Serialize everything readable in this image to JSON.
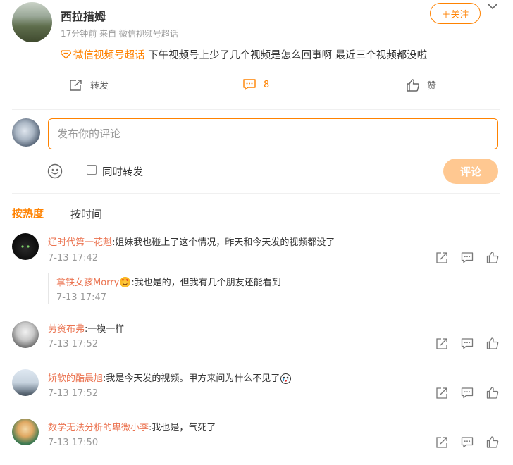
{
  "post": {
    "author": "西拉措姆",
    "meta": "17分钟前  来自 微信视频号超话",
    "follow_label": "＋关注",
    "topic": "微信视频号超话",
    "text": " 下午视频号上少了几个视频是怎么回事啊 最近三个视频都没啦",
    "actions": {
      "repost_label": "转发",
      "comment_count": "8",
      "like_label": "赞"
    }
  },
  "composer": {
    "placeholder": "发布你的评论",
    "repost_checkbox_label": "同时转发",
    "submit_label": "评论"
  },
  "sort": {
    "hot_label": "按热度",
    "time_label": "按时间"
  },
  "comments": [
    {
      "name": "辽时代第一花魁",
      "text": ":姐妹我也碰上了这个情况，昨天和今天发的视频都没了",
      "time": "7-13 17:42",
      "reply": {
        "name": "拿铁女孩Morry",
        "text": ":我也是的，但我有几个朋友还能看到",
        "time": "7-13 17:47"
      }
    },
    {
      "name": "劳资布弗",
      "text": ":一模一样",
      "time": "7-13 17:52"
    },
    {
      "name": "娇软的酷晨旭",
      "text": ":我是今天发的视频。甲方来问为什么不见了",
      "time": "7-13 17:52"
    },
    {
      "name": "数学无法分析的卑微小李",
      "text": ":我也是，气死了",
      "time": "7-13 17:50"
    }
  ],
  "colors": {
    "accent": "#ff8200",
    "name": "#eb7350",
    "muted": "#999999",
    "submit_disabled": "#ffc891"
  },
  "icons": [
    "chevron-down-icon",
    "super-topic-icon",
    "repost-icon",
    "comment-icon",
    "like-icon",
    "emoji-icon",
    "share-icon"
  ]
}
